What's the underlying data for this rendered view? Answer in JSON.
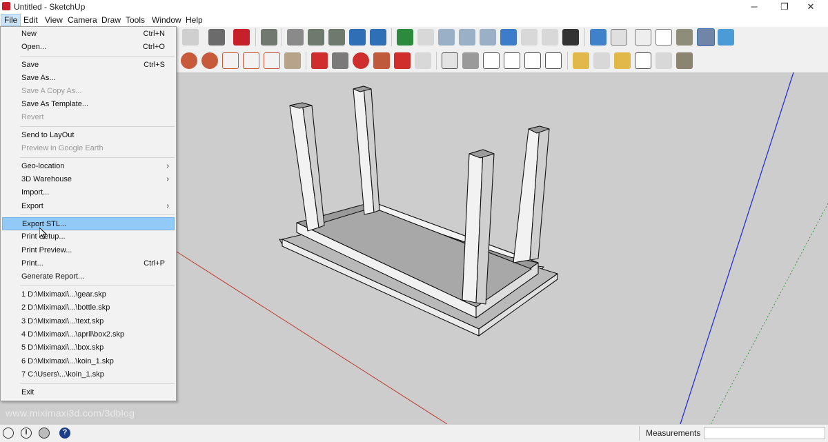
{
  "window": {
    "title": "Untitled - SketchUp",
    "minimize": "─",
    "maximize": "❐",
    "close": "✕"
  },
  "menubar": [
    "File",
    "Edit",
    "View",
    "Camera",
    "Draw",
    "Tools",
    "Window",
    "Help"
  ],
  "file_menu": {
    "new": {
      "label": "New",
      "shortcut": "Ctrl+N"
    },
    "open": {
      "label": "Open...",
      "shortcut": "Ctrl+O"
    },
    "save": {
      "label": "Save",
      "shortcut": "Ctrl+S"
    },
    "save_as": {
      "label": "Save As..."
    },
    "save_copy_as": {
      "label": "Save A Copy As..."
    },
    "save_as_template": {
      "label": "Save As Template..."
    },
    "revert": {
      "label": "Revert"
    },
    "send_to_layout": {
      "label": "Send to LayOut"
    },
    "preview_google_earth": {
      "label": "Preview in Google Earth"
    },
    "geo_location": {
      "label": "Geo-location",
      "arrow": "›"
    },
    "warehouse": {
      "label": "3D Warehouse",
      "arrow": "›"
    },
    "import": {
      "label": "Import..."
    },
    "export": {
      "label": "Export",
      "arrow": "›"
    },
    "export_stl": {
      "label": "Export STL..."
    },
    "print_setup": {
      "label": "Print Setup..."
    },
    "print_preview": {
      "label": "Print Preview..."
    },
    "print": {
      "label": "Print...",
      "shortcut": "Ctrl+P"
    },
    "generate_report": {
      "label": "Generate Report..."
    },
    "recent": [
      "1 D:\\Miximaxi\\...\\gear.skp",
      "2 D:\\Miximaxi\\...\\bottle.skp",
      "3 D:\\Miximaxi\\...\\text.skp",
      "4 D:\\Miximaxi\\...\\april\\box2.skp",
      "5 D:\\Miximaxi\\...\\box.skp",
      "6 D:\\Miximaxi\\...\\koin_1.skp",
      "7 C:\\Users\\...\\koin_1.skp"
    ],
    "exit": {
      "label": "Exit"
    }
  },
  "watermark": "www.miximaxi3d.com/3dblog",
  "statusbar": {
    "measurements_label": "Measurements",
    "measurements_value": "",
    "help_icon_text": "?",
    "info_icon_text": "i"
  },
  "colors": {
    "viewport_bg": "#cdcdcd",
    "menu_highlight": "#91c9f7",
    "axis_red": "#c0392b",
    "axis_blue": "#2133d6",
    "axis_green": "#2e9a3a"
  }
}
